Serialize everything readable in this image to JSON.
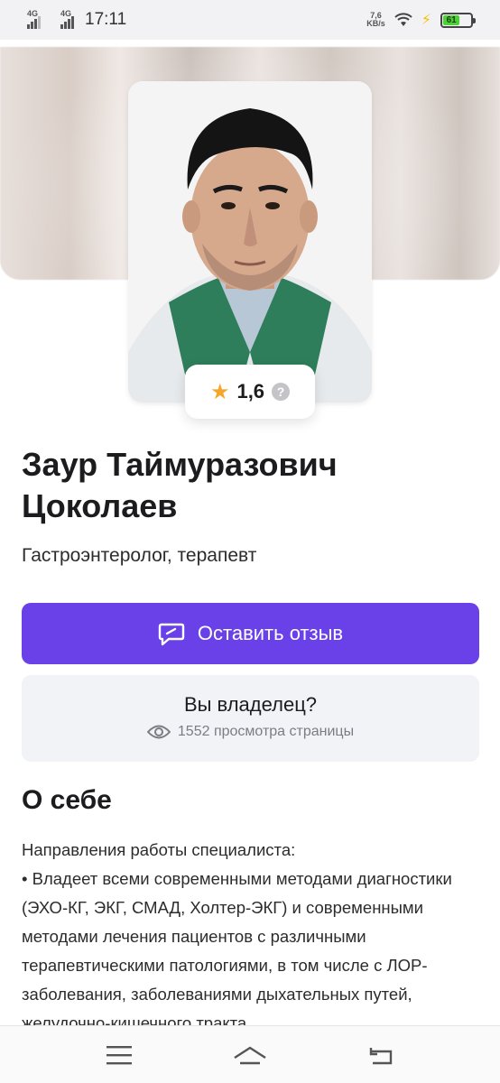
{
  "status_bar": {
    "network1": "4G",
    "network2": "4G",
    "time": "17:11",
    "net_speed_value": "7,6",
    "net_speed_unit": "KB/s",
    "battery": "61"
  },
  "profile": {
    "rating": "1,6",
    "name": "Заур Таймуразович Цоколаев",
    "specialty": "Гастроэнтеролог, терапевт",
    "photo_icon": "doctor-portrait"
  },
  "actions": {
    "review_label": "Оставить отзыв",
    "review_icon": "chat-bubble-icon"
  },
  "owner": {
    "title": "Вы владелец?",
    "views_text": "1552 просмотра страницы"
  },
  "about": {
    "title": "О себе",
    "lines": [
      "Направления работы специалиста:",
      "• Владеет всеми современными методами диагностики (ЭХО-КГ, ЭКГ, СМАД, Холтер-ЭКГ) и современными методами лечения пациентов с различными терапевтическими патологиями, в том числе с ЛОР-заболевания, заболеваниями дыхательных путей, желудочно-кишечного тракта"
    ]
  },
  "nav": {
    "menu_icon": "menu-icon",
    "home_icon": "home-icon",
    "back_icon": "back-icon"
  },
  "colors": {
    "accent": "#6a41e8",
    "star": "#f4a72a",
    "battery": "#4cd137"
  }
}
